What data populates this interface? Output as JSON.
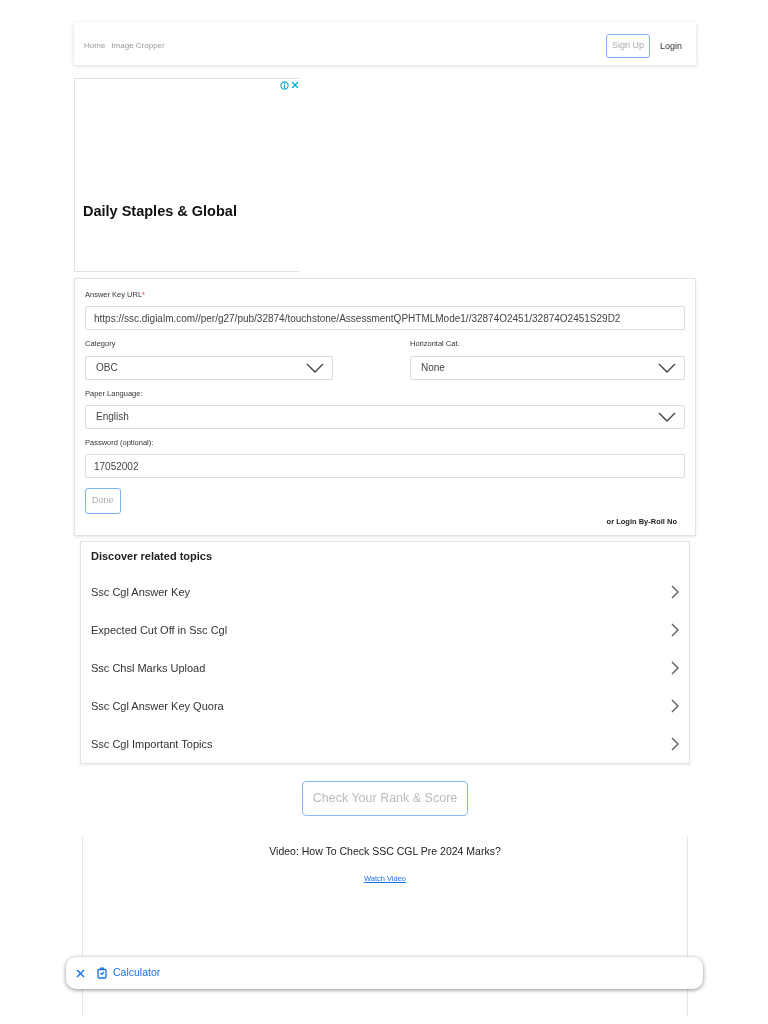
{
  "nav": {
    "breadcrumbs": [
      "Home",
      "Image Cropper"
    ],
    "signup": "Sign Up",
    "login": "Login"
  },
  "ad": {
    "headline": "Daily Staples & Global"
  },
  "form": {
    "url_label": "Answer Key URL",
    "required_mark": "*",
    "url_value": "https://ssc.digialm.com//per/g27/pub/32874/touchstone/AssessmentQPHTMLMode1//32874O2451/32874O2451S29D2",
    "category_label": "Category",
    "category_value": "OBC",
    "horizontal_label": "Horizontal Cat.",
    "horizontal_value": "None",
    "language_label": "Paper Language:",
    "language_value": "English",
    "password_label": "Password (optional):",
    "password_value": "17052002",
    "done": "Done",
    "roll_link": "or Login By-Roll No"
  },
  "related": {
    "title": "Discover related topics",
    "items": [
      "Ssc Cgl Answer Key",
      "Expected Cut Off in Ssc Cgl",
      "Ssc Chsl Marks Upload",
      "Ssc Cgl Answer Key Quora",
      "Ssc Cgl Important Topics"
    ]
  },
  "rank_button": "Check Your Rank & Score",
  "video": {
    "title": "Video: How To Check SSC CGL Pre 2024 Marks?",
    "link": "Watch Video"
  },
  "bottom_bar": {
    "label": "Calculator"
  }
}
